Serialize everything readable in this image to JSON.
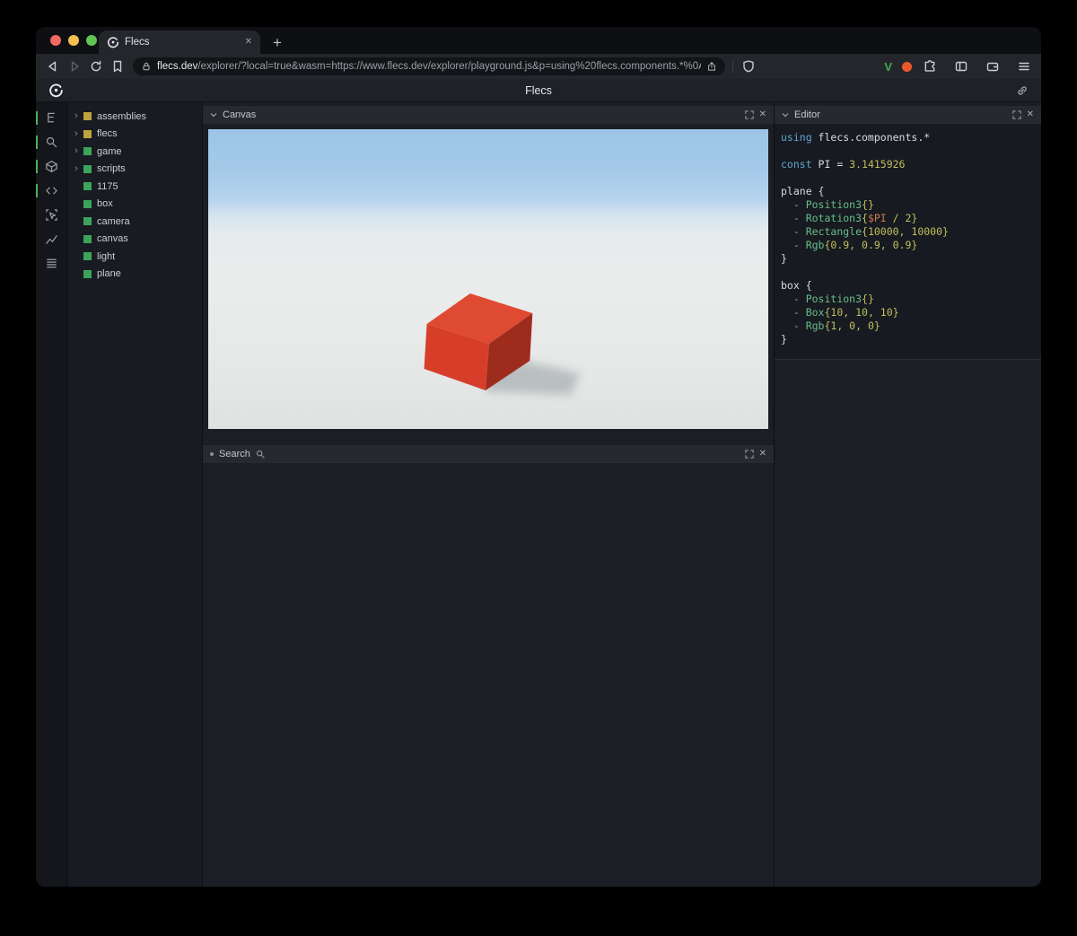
{
  "browser": {
    "tab_title": "Flecs",
    "url_host": "flecs.dev",
    "url_rest": "/explorer/?local=true&wasm=https://www.flecs.dev/explorer/playground.js&p=using%20flecs.components.*%0A…",
    "extensions": {
      "vimium_label": "V"
    },
    "toolbar_icon_names": [
      "back-icon",
      "forward-icon",
      "reload-icon",
      "bookmarks-icon",
      "lock-icon",
      "share-icon",
      "shield-icon",
      "vimium-extension-icon",
      "orange-dot-extension-icon",
      "extensions-puzzle-icon",
      "sidebar-toggle-icon",
      "wallet-icon",
      "menu-icon"
    ]
  },
  "page": {
    "title": "Flecs"
  },
  "rail": {
    "items": [
      {
        "name": "tree-icon",
        "active": true
      },
      {
        "name": "search-icon",
        "active": true
      },
      {
        "name": "cube-icon",
        "active": true
      },
      {
        "name": "code-icon",
        "active": true
      },
      {
        "name": "inspector-icon",
        "active": false
      },
      {
        "name": "chart-icon",
        "active": false
      },
      {
        "name": "stats-icon",
        "active": false
      }
    ],
    "active_color": "#4cb05a"
  },
  "tree": {
    "items": [
      {
        "label": "assemblies",
        "color": "#bfa23d",
        "expandable": true
      },
      {
        "label": "flecs",
        "color": "#bfa23d",
        "expandable": true
      },
      {
        "label": "game",
        "color": "#3da35c",
        "expandable": true
      },
      {
        "label": "scripts",
        "color": "#3da35c",
        "expandable": true
      },
      {
        "label": "1175",
        "color": "#3da35c",
        "expandable": false
      },
      {
        "label": "box",
        "color": "#3da35c",
        "expandable": false
      },
      {
        "label": "camera",
        "color": "#3da35c",
        "expandable": false
      },
      {
        "label": "canvas",
        "color": "#3da35c",
        "expandable": false
      },
      {
        "label": "light",
        "color": "#3da35c",
        "expandable": false
      },
      {
        "label": "plane",
        "color": "#3da35c",
        "expandable": false
      }
    ]
  },
  "panels": {
    "canvas": {
      "title": "Canvas"
    },
    "search": {
      "title": "Search"
    },
    "editor": {
      "title": "Editor"
    }
  },
  "scene": {
    "sky_color": "#9cc4e6",
    "ground_color": "#e8eae9",
    "box_color_top": "#df4a32",
    "box_color_front": "#d63e2a",
    "box_color_side": "#9d2c1d"
  },
  "editor": {
    "code": [
      [
        [
          "kw",
          "using "
        ],
        [
          "ent",
          "flecs.components.*"
        ]
      ],
      [],
      [
        [
          "kw",
          "const "
        ],
        [
          "ent",
          "PI = "
        ],
        [
          "num",
          "3.1415926"
        ]
      ],
      [],
      [
        [
          "ent",
          "plane {"
        ]
      ],
      [
        [
          "punc",
          "  - "
        ],
        [
          "comp",
          "Position3"
        ],
        [
          "num",
          "{}"
        ]
      ],
      [
        [
          "punc",
          "  - "
        ],
        [
          "comp",
          "Rotation3"
        ],
        [
          "num",
          "{"
        ],
        [
          "var",
          "$PI"
        ],
        [
          "num",
          " / 2}"
        ]
      ],
      [
        [
          "punc",
          "  - "
        ],
        [
          "comp",
          "Rectangle"
        ],
        [
          "num",
          "{10000, 10000}"
        ]
      ],
      [
        [
          "punc",
          "  - "
        ],
        [
          "comp",
          "Rgb"
        ],
        [
          "num",
          "{0.9, 0.9, 0.9}"
        ]
      ],
      [
        [
          "ent",
          "}"
        ]
      ],
      [],
      [
        [
          "ent",
          "box {"
        ]
      ],
      [
        [
          "punc",
          "  - "
        ],
        [
          "comp",
          "Position3"
        ],
        [
          "num",
          "{}"
        ]
      ],
      [
        [
          "punc",
          "  - "
        ],
        [
          "comp",
          "Box"
        ],
        [
          "num",
          "{10, 10, 10}"
        ]
      ],
      [
        [
          "punc",
          "  - "
        ],
        [
          "comp",
          "Rgb"
        ],
        [
          "num",
          "{1, 0, 0}"
        ]
      ],
      [
        [
          "ent",
          "}"
        ]
      ]
    ]
  }
}
